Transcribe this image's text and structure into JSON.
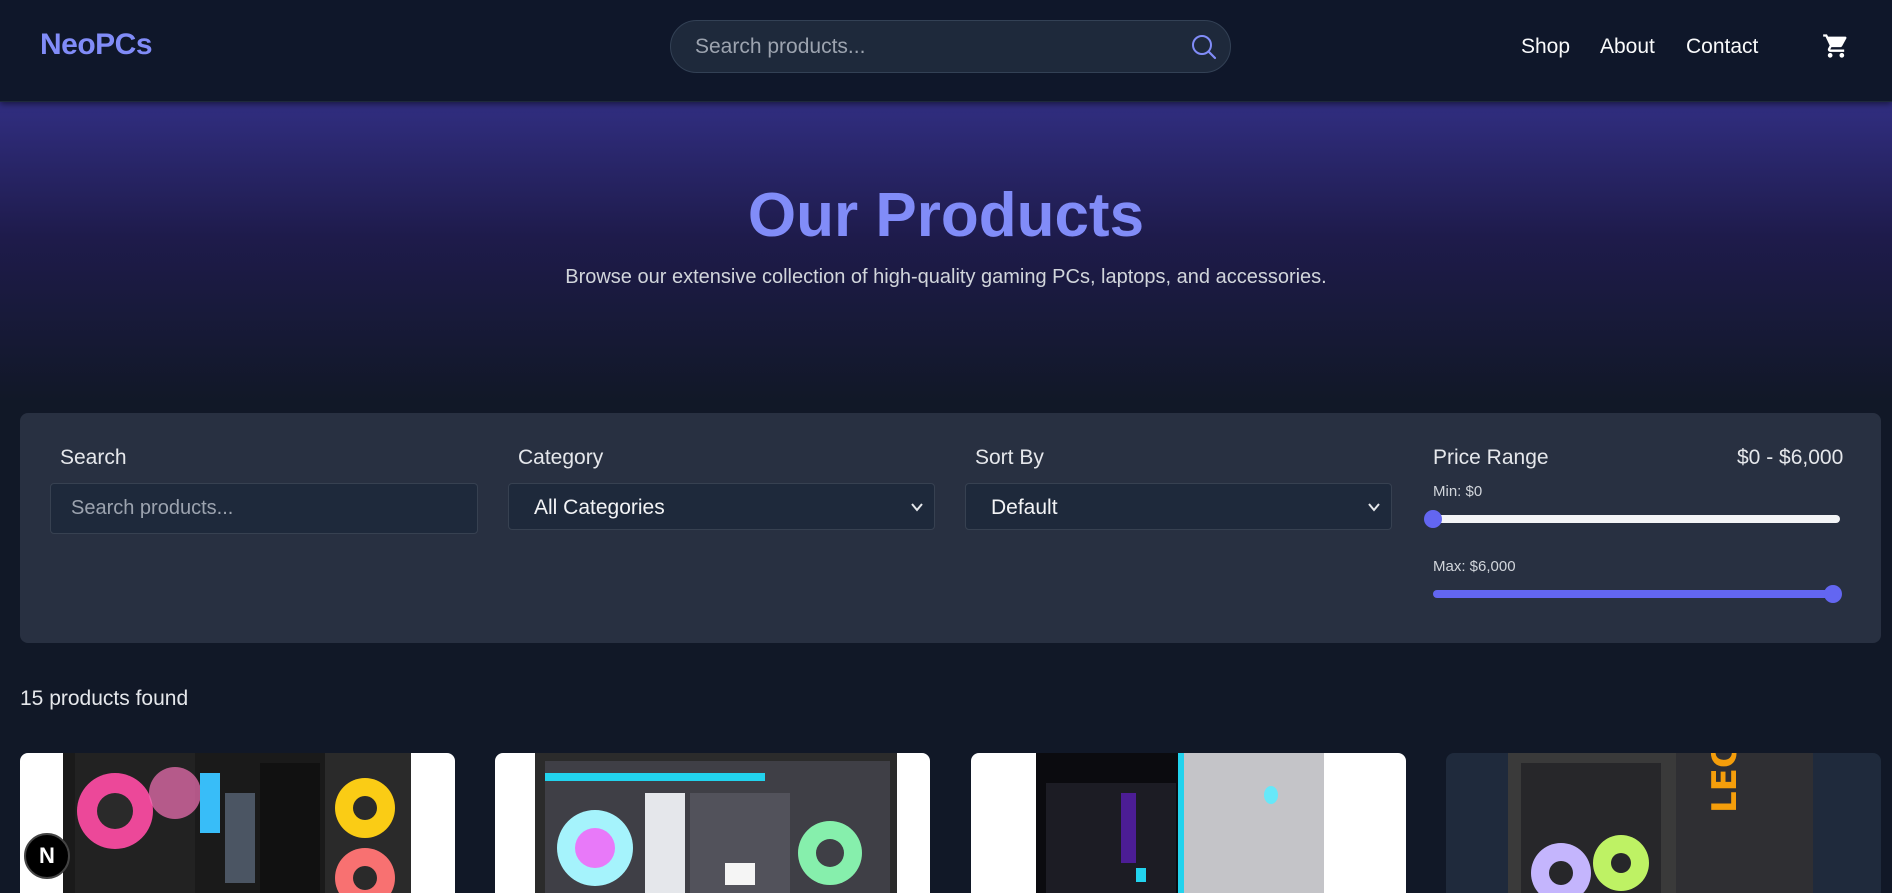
{
  "header": {
    "logo": "NeoPCs",
    "search_placeholder": "Search products...",
    "nav": [
      "Shop",
      "About",
      "Contact"
    ]
  },
  "hero": {
    "title": "Our Products",
    "subtitle": "Browse our extensive collection of high-quality gaming PCs, laptops, and accessories."
  },
  "filters": {
    "search_label": "Search",
    "search_placeholder": "Search products...",
    "category_label": "Category",
    "category_value": "All Categories",
    "sort_label": "Sort By",
    "sort_value": "Default",
    "price_label": "Price Range",
    "price_range": "$0 - $6,000",
    "min_label": "Min: $0",
    "max_label": "Max: $6,000",
    "min_fraction": 0,
    "max_fraction": 1
  },
  "results": {
    "count_text": "15 products found"
  },
  "colors": {
    "accent": "#6366f1",
    "logo": "#818cf8",
    "bg": "#111827"
  },
  "badge": {
    "letter": "N"
  }
}
